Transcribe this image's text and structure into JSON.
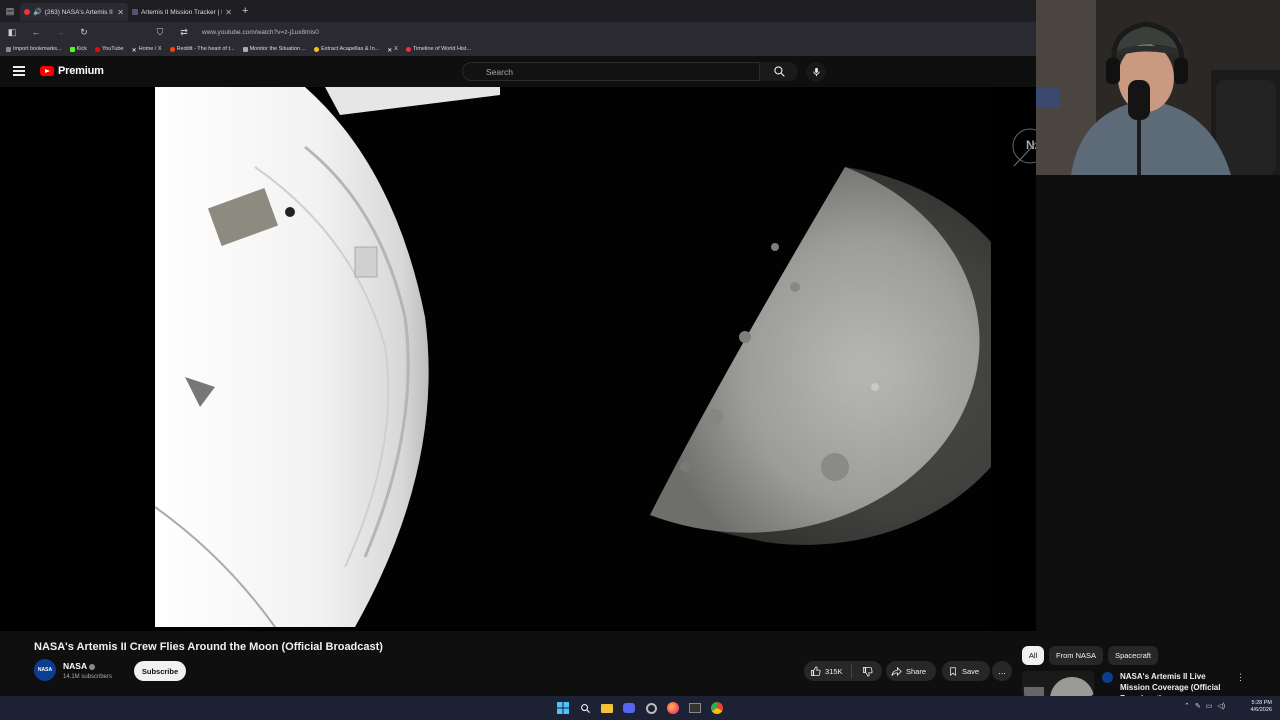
{
  "browser": {
    "tabs": [
      {
        "title": "(263) NASA's Artemis II Cre",
        "active": true
      },
      {
        "title": "Artemis II Mission Tracker | Live",
        "active": false
      }
    ],
    "new_tab": "+",
    "url": "www.youtube.com/watch?v=z-j1ux8mis0",
    "bookmarks": [
      {
        "label": "Import bookmarks...",
        "icon": "import-icon",
        "color": "#888888"
      },
      {
        "label": "Kick",
        "icon": "kick-icon",
        "color": "#53fc18"
      },
      {
        "label": "YouTube",
        "icon": "youtube-icon",
        "color": "#ff0000"
      },
      {
        "label": "Home / X",
        "icon": "x-icon",
        "color": "#ffffff"
      },
      {
        "label": "Reddit - The heart of t...",
        "icon": "reddit-icon",
        "color": "#ff4500"
      },
      {
        "label": "Monitor the Situation ...",
        "icon": "monitor-icon",
        "color": "#aaaaaa"
      },
      {
        "label": "Extract Acapellas & In...",
        "icon": "acapella-icon",
        "color": "#f5c518"
      },
      {
        "label": "X",
        "icon": "x-icon",
        "color": "#ffffff"
      },
      {
        "label": "Timeline of World Hist...",
        "icon": "timeline-icon",
        "color": "#e33333"
      }
    ]
  },
  "youtube": {
    "logo_text": "Premium",
    "search_placeholder": "Search"
  },
  "video": {
    "title": "NASA's Artemis II Crew Flies Around the Moon (Official Broadcast)",
    "channel": "NASA",
    "avatar_text": "NASA",
    "subscribers": "14.1M subscribers",
    "subscribe_label": "Subscribe",
    "likes": "315K",
    "share_label": "Share",
    "save_label": "Save",
    "more_label": "..."
  },
  "overlay": {
    "watermark_text": "NA"
  },
  "related": {
    "chips": [
      {
        "label": "All",
        "active": true
      },
      {
        "label": "From NASA",
        "active": false
      },
      {
        "label": "Spacecraft",
        "active": false
      }
    ],
    "item": {
      "title": "NASA's Artemis II Live Mission Coverage (Official Broadcast)"
    }
  },
  "taskbar": {
    "time": "5:28 PM",
    "date": "4/6/2026"
  },
  "colors": {
    "accent": "#ff0000",
    "nasa_blue": "#0b3d91",
    "background": "#0f0f0f"
  }
}
